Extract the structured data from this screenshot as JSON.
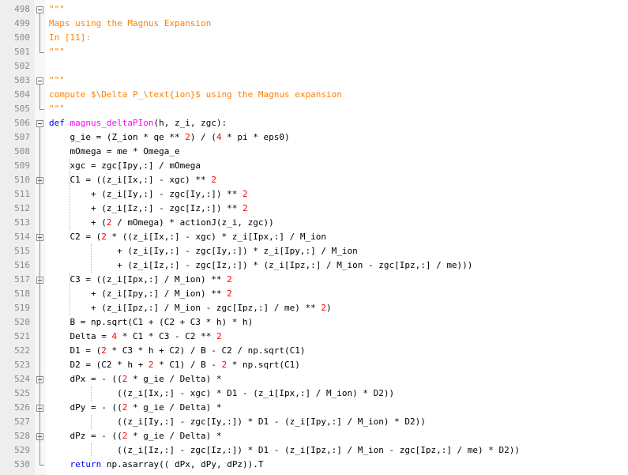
{
  "editor": {
    "lines": [
      {
        "num": "498",
        "tokens": [
          {
            "t": "\"\"\"",
            "c": "s"
          }
        ]
      },
      {
        "num": "499",
        "tokens": [
          {
            "t": "Maps using the Magnus Expansion",
            "c": "s"
          }
        ]
      },
      {
        "num": "500",
        "tokens": [
          {
            "t": "In [11]:",
            "c": "s"
          }
        ]
      },
      {
        "num": "501",
        "tokens": [
          {
            "t": "\"\"\"",
            "c": "s"
          }
        ]
      },
      {
        "num": "502",
        "tokens": []
      },
      {
        "num": "503",
        "tokens": [
          {
            "t": "\"\"\"",
            "c": "s"
          }
        ]
      },
      {
        "num": "504",
        "tokens": [
          {
            "t": "compute $\\Delta P_\\text{ion}$ using the Magnus expansion",
            "c": "s"
          }
        ]
      },
      {
        "num": "505",
        "tokens": [
          {
            "t": "\"\"\"",
            "c": "s"
          }
        ]
      },
      {
        "num": "506",
        "tokens": [
          {
            "t": "def",
            "c": "k"
          },
          {
            "t": " "
          },
          {
            "t": "magnus_deltaPIon",
            "c": "fn"
          },
          {
            "t": "(h, z_i, zgc):"
          }
        ]
      },
      {
        "num": "507",
        "tokens": [
          {
            "t": "    g_ie = (Z_ion * qe ** "
          },
          {
            "t": "2",
            "c": "n"
          },
          {
            "t": ") / ("
          },
          {
            "t": "4",
            "c": "n"
          },
          {
            "t": " * pi * eps0)"
          }
        ]
      },
      {
        "num": "508",
        "tokens": [
          {
            "t": "    mOmega = me * Omega_e"
          }
        ]
      },
      {
        "num": "509",
        "tokens": [
          {
            "t": "    xgc = zgc[Ipy,:] / mOmega"
          }
        ]
      },
      {
        "num": "510",
        "tokens": [
          {
            "t": "    C1 = ((z_i[Ix,:] - xgc) ** "
          },
          {
            "t": "2",
            "c": "n"
          }
        ]
      },
      {
        "num": "511",
        "tokens": [
          {
            "t": "        + (z_i[Iy,:] - zgc[Iy,:]) ** "
          },
          {
            "t": "2",
            "c": "n"
          }
        ]
      },
      {
        "num": "512",
        "tokens": [
          {
            "t": "        + (z_i[Iz,:] - zgc[Iz,:]) ** "
          },
          {
            "t": "2",
            "c": "n"
          }
        ]
      },
      {
        "num": "513",
        "tokens": [
          {
            "t": "        + ("
          },
          {
            "t": "2",
            "c": "n"
          },
          {
            "t": " / mOmega) * actionJ(z_i, zgc))"
          }
        ]
      },
      {
        "num": "514",
        "tokens": [
          {
            "t": "    C2 = ("
          },
          {
            "t": "2",
            "c": "n"
          },
          {
            "t": " * ((z_i[Ix,:] - xgc) * z_i[Ipx,:] / M_ion"
          }
        ]
      },
      {
        "num": "515",
        "tokens": [
          {
            "t": "             + (z_i[Iy,:] - zgc[Iy,:]) * z_i[Ipy,:] / M_ion"
          }
        ]
      },
      {
        "num": "516",
        "tokens": [
          {
            "t": "             + (z_i[Iz,:] - zgc[Iz,:]) * (z_i[Ipz,:] / M_ion - zgc[Ipz,:] / me)))"
          }
        ]
      },
      {
        "num": "517",
        "tokens": [
          {
            "t": "    C3 = ((z_i[Ipx,:] / M_ion) ** "
          },
          {
            "t": "2",
            "c": "n"
          }
        ]
      },
      {
        "num": "518",
        "tokens": [
          {
            "t": "        + (z_i[Ipy,:] / M_ion) ** "
          },
          {
            "t": "2",
            "c": "n"
          }
        ]
      },
      {
        "num": "519",
        "tokens": [
          {
            "t": "        + (z_i[Ipz,:] / M_ion - zgc[Ipz,:] / me) ** "
          },
          {
            "t": "2",
            "c": "n"
          },
          {
            "t": ")"
          }
        ]
      },
      {
        "num": "520",
        "tokens": [
          {
            "t": "    B = np.sqrt(C1 + (C2 + C3 * h) * h)"
          }
        ]
      },
      {
        "num": "521",
        "tokens": [
          {
            "t": "    Delta = "
          },
          {
            "t": "4",
            "c": "n"
          },
          {
            "t": " * C1 * C3 - C2 ** "
          },
          {
            "t": "2",
            "c": "n"
          }
        ]
      },
      {
        "num": "522",
        "tokens": [
          {
            "t": "    D1 = ("
          },
          {
            "t": "2",
            "c": "n"
          },
          {
            "t": " * C3 * h + C2) / B - C2 / np.sqrt(C1)"
          }
        ]
      },
      {
        "num": "523",
        "tokens": [
          {
            "t": "    D2 = (C2 * h + "
          },
          {
            "t": "2",
            "c": "n"
          },
          {
            "t": " * C1) / B - "
          },
          {
            "t": "2",
            "c": "n"
          },
          {
            "t": " * np.sqrt(C1)"
          }
        ]
      },
      {
        "num": "524",
        "tokens": [
          {
            "t": "    dPx = - (("
          },
          {
            "t": "2",
            "c": "n"
          },
          {
            "t": " * g_ie / Delta) *"
          }
        ]
      },
      {
        "num": "525",
        "tokens": [
          {
            "t": "             ((z_i[Ix,:] - xgc) * D1 - (z_i[Ipx,:] / M_ion) * D2))"
          }
        ]
      },
      {
        "num": "526",
        "tokens": [
          {
            "t": "    dPy = - (("
          },
          {
            "t": "2",
            "c": "n"
          },
          {
            "t": " * g_ie / Delta) *"
          }
        ]
      },
      {
        "num": "527",
        "tokens": [
          {
            "t": "             ((z_i[Iy,:] - zgc[Iy,:]) * D1 - (z_i[Ipy,:] / M_ion) * D2))"
          }
        ]
      },
      {
        "num": "528",
        "tokens": [
          {
            "t": "    dPz = - (("
          },
          {
            "t": "2",
            "c": "n"
          },
          {
            "t": " * g_ie / Delta) *"
          }
        ]
      },
      {
        "num": "529",
        "tokens": [
          {
            "t": "             ((z_i[Iz,:] - zgc[Iz,:]) * D1 - (z_i[Ipz,:] / M_ion - zgc[Ipz,:] / me) * D2))"
          }
        ]
      },
      {
        "num": "530",
        "tokens": [
          {
            "t": "    "
          },
          {
            "t": "return",
            "c": "k"
          },
          {
            "t": " np.asarray(( dPx, dPy, dPz)).T"
          }
        ]
      }
    ]
  },
  "colors": {
    "keyword": "#0000ff",
    "function_name": "#ff00ff",
    "string": "#ff8000",
    "number": "#ff0000",
    "gutter": "#eeeeee"
  },
  "icons": [
    "fold-minus-icon"
  ]
}
